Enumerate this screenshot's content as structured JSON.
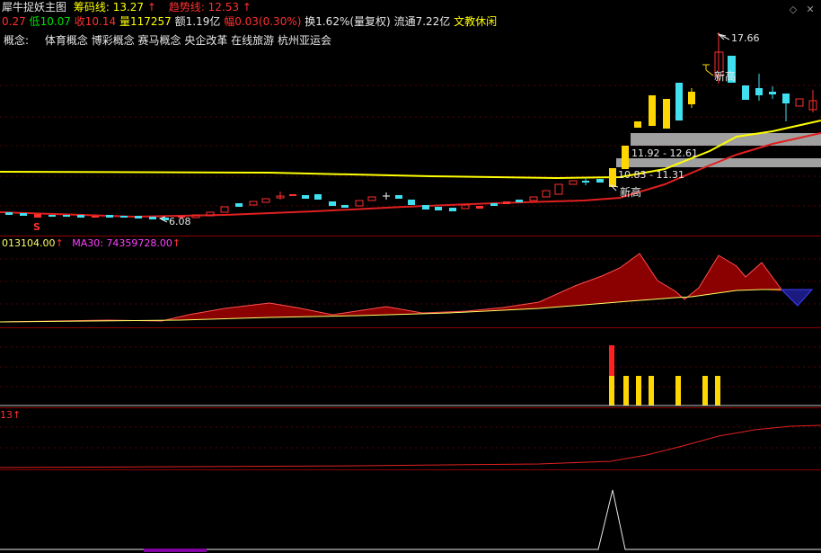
{
  "header": {
    "title": "犀牛捉妖主图",
    "chip_line_label": "筹码线: ",
    "chip_line_value": "13.27",
    "chip_line_arrow": "↑",
    "trend_line_label": "趋势线: ",
    "trend_line_value": "12.53",
    "trend_line_arrow": "↑"
  },
  "quote": {
    "open_frag": "0.27",
    "low_label": "低",
    "low_value": "10.07",
    "close_label": "收",
    "close_value": "10.14",
    "volume_label": "量",
    "volume_value": "117257",
    "amount_label": "额",
    "amount_value": "1.19亿",
    "change_label": "幅",
    "change_value": "0.03(0.30%)",
    "turnover": "换1.62%(量复权)",
    "float_cap": "流通7.22亿",
    "industry": "文教休闲"
  },
  "concepts": {
    "label": "概念:",
    "items": "体育概念 博彩概念 赛马概念 央企改革 在线旅游 杭州亚运会"
  },
  "annotations": {
    "high_price": "17.66",
    "low_price": "6.08",
    "new_high_1": "新高",
    "new_high_2": "新高",
    "s_marker": "S",
    "zone_1": "11.92 - 12.61",
    "zone_2": "10.83 - 11.31"
  },
  "volume_panel": {
    "value_label": "013104.00",
    "value_arrow": "↑",
    "ma_label": "MA30: ",
    "ma_value": "74359728.00",
    "ma_arrow": "↑"
  },
  "panel4": {
    "value_label": "13",
    "value_arrow": "↑"
  },
  "window_controls": {
    "restore": "◇",
    "close": "✕"
  },
  "colors": {
    "bg": "#000000",
    "up": "#ff3030",
    "down": "#40e0f0",
    "yellow": "#ffff00",
    "magenta": "#ff40ff",
    "separator": "#8a0000",
    "zone": "#a0a0a0",
    "vol_fill": "#8b0000"
  }
}
